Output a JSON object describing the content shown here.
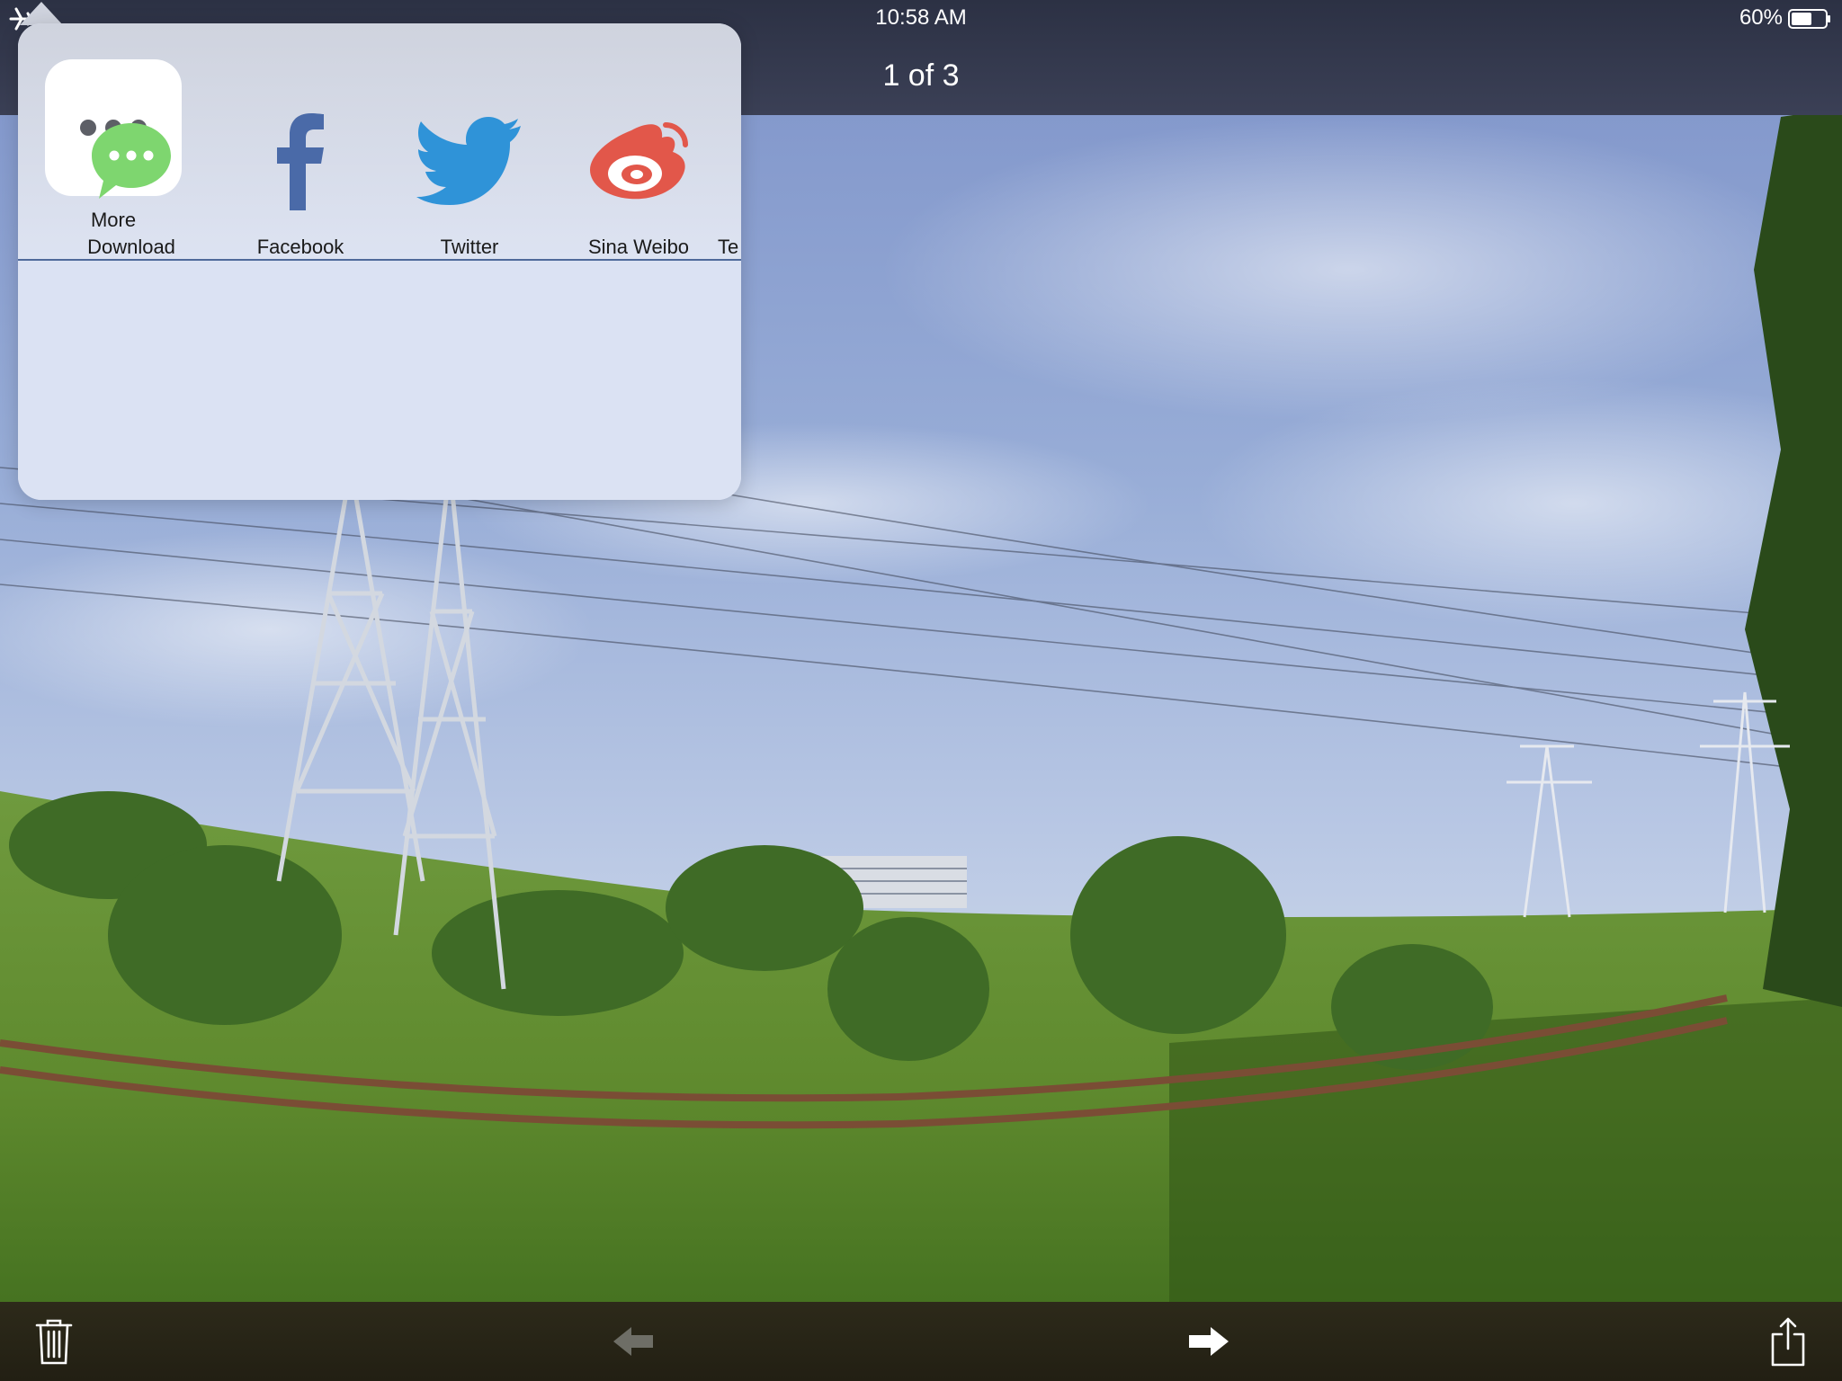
{
  "status_bar": {
    "time": "10:58 AM",
    "battery_percent": "60%"
  },
  "nav": {
    "title": "1 of 3"
  },
  "share_sheet": {
    "more_label": "More",
    "targets": [
      {
        "label": "Download",
        "icon": "chat-bubble-icon",
        "color": "#7ed66f"
      },
      {
        "label": "Facebook",
        "icon": "facebook-icon",
        "color": "#4a6aa8"
      },
      {
        "label": "Twitter",
        "icon": "twitter-bird-icon",
        "color": "#2f93d8"
      },
      {
        "label": "Sina Weibo",
        "icon": "weibo-icon",
        "color": "#e2574a"
      },
      {
        "label": "Te",
        "icon": "",
        "color": ""
      }
    ]
  },
  "toolbar": {
    "icons": [
      "trash-icon",
      "arrow-left-icon",
      "arrow-right-icon",
      "share-icon"
    ]
  }
}
